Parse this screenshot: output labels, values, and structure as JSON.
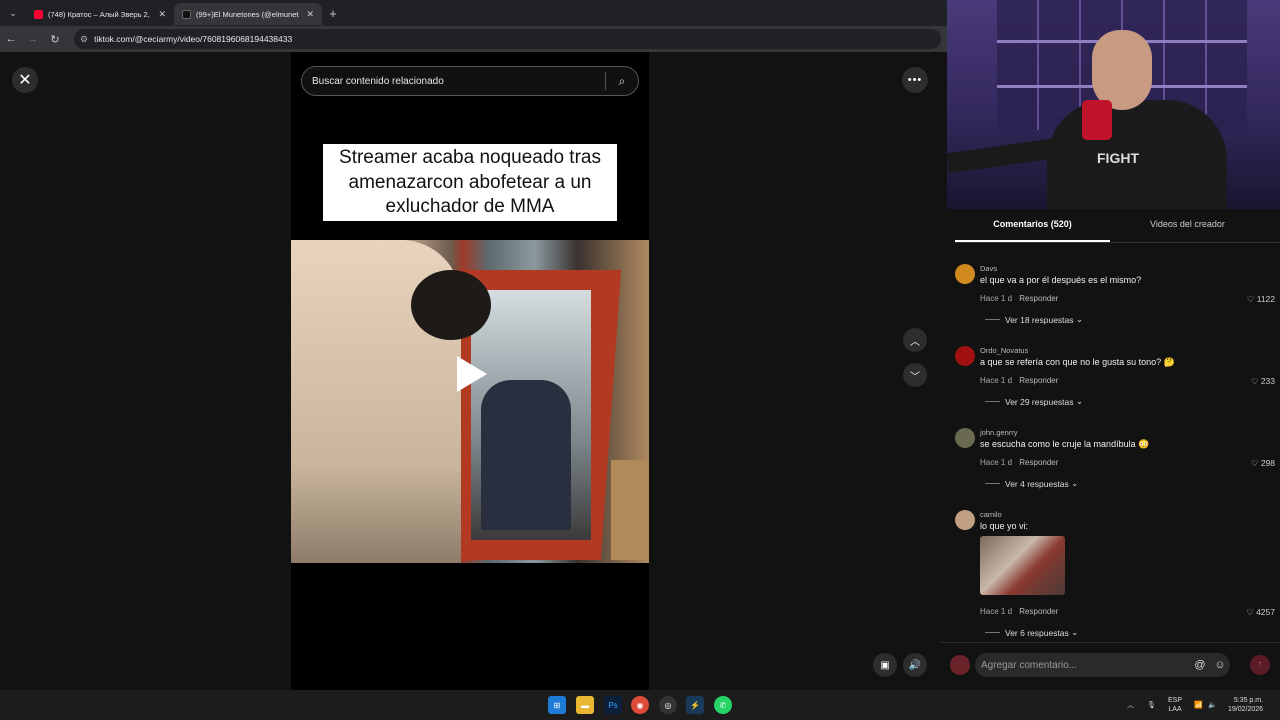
{
  "browser": {
    "tabs": [
      {
        "title": "(748) Кратос – Алый Зверь 2, ",
        "active": false,
        "favicon_color": "#ff0033"
      },
      {
        "title": "(99+)El Munetones (@elmunet",
        "active": true,
        "favicon_color": "#111111"
      }
    ],
    "url": "tiktok.com/@ceciarmy/video/7608196068194438433"
  },
  "video": {
    "search_placeholder": "Buscar contenido relacionado",
    "caption": "Streamer acaba noqueado tras amenazarcon abofetear a un exluchador de MMA"
  },
  "panel": {
    "tabs": [
      "Comentarios (520)",
      "Videos del creador"
    ],
    "reply_label": "Responder",
    "comments": [
      {
        "user": "Davs",
        "text": "el que va a por él después es el mismo?",
        "time": "Hace 1 d",
        "likes": "1122",
        "replies": "Ver 18 respuestas",
        "avatar_color": "#d08a20"
      },
      {
        "user": "Ordo_Novatus",
        "text": "a que se refería con que no le gusta su tono? 🤔",
        "time": "Hace 1 d",
        "likes": "233",
        "replies": "Ver 29 respuestas",
        "avatar_color": "#a01010"
      },
      {
        "user": "john.genrry",
        "text": "se escucha como le cruje la mandíbula 😳",
        "time": "Hace 1 d",
        "likes": "298",
        "replies": "Ver 4 respuestas",
        "avatar_color": "#6a6a50"
      },
      {
        "user": "camilo",
        "text": "lo que yo vi:",
        "time": "Hace 1 d",
        "likes": "4257",
        "replies": "Ver 6 respuestas",
        "avatar_color": "#c0a080"
      }
    ],
    "add_placeholder": "Agregar comentario..."
  },
  "webcam": {
    "shirt_text": "FIGHT"
  },
  "taskbar": {
    "lang": "ESP",
    "lang2": "LAA",
    "time": "5:35 p.m.",
    "date": "19/02/2026"
  }
}
